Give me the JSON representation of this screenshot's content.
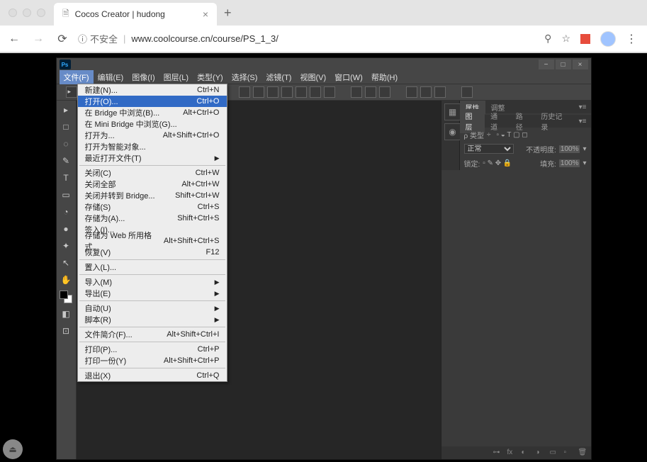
{
  "browser": {
    "tab_title": "Cocos Creator | hudong",
    "insecure_label": "不安全",
    "url": "www.coolcourse.cn/course/PS_1_3/"
  },
  "ps": {
    "logo": "Ps",
    "menubar": [
      "文件(F)",
      "编辑(E)",
      "图像(I)",
      "图层(L)",
      "类型(Y)",
      "选择(S)",
      "滤镜(T)",
      "视图(V)",
      "窗口(W)",
      "帮助(H)"
    ],
    "win_ctrls": [
      "−",
      "□",
      "×"
    ]
  },
  "file_menu": {
    "groups": [
      [
        {
          "label": "新建(N)...",
          "shortcut": "Ctrl+N"
        },
        {
          "label": "打开(O)...",
          "shortcut": "Ctrl+O",
          "hover": true
        },
        {
          "label": "在 Bridge 中浏览(B)...",
          "shortcut": "Alt+Ctrl+O"
        },
        {
          "label": "在 Mini Bridge 中浏览(G)..."
        },
        {
          "label": "打开为...",
          "shortcut": "Alt+Shift+Ctrl+O"
        },
        {
          "label": "打开为智能对象..."
        },
        {
          "label": "最近打开文件(T)",
          "submenu": true
        }
      ],
      [
        {
          "label": "关闭(C)",
          "shortcut": "Ctrl+W"
        },
        {
          "label": "关闭全部",
          "shortcut": "Alt+Ctrl+W"
        },
        {
          "label": "关闭并转到 Bridge...",
          "shortcut": "Shift+Ctrl+W"
        },
        {
          "label": "存储(S)",
          "shortcut": "Ctrl+S"
        },
        {
          "label": "存储为(A)...",
          "shortcut": "Shift+Ctrl+S"
        },
        {
          "label": "签入(I)..."
        },
        {
          "label": "存储为 Web 所用格式...",
          "shortcut": "Alt+Shift+Ctrl+S"
        },
        {
          "label": "恢复(V)",
          "shortcut": "F12"
        }
      ],
      [
        {
          "label": "置入(L)..."
        }
      ],
      [
        {
          "label": "导入(M)",
          "submenu": true
        },
        {
          "label": "导出(E)",
          "submenu": true
        }
      ],
      [
        {
          "label": "自动(U)",
          "submenu": true
        },
        {
          "label": "脚本(R)",
          "submenu": true
        }
      ],
      [
        {
          "label": "文件简介(F)...",
          "shortcut": "Alt+Shift+Ctrl+I"
        }
      ],
      [
        {
          "label": "打印(P)...",
          "shortcut": "Ctrl+P"
        },
        {
          "label": "打印一份(Y)",
          "shortcut": "Alt+Shift+Ctrl+P"
        }
      ],
      [
        {
          "label": "退出(X)",
          "shortcut": "Ctrl+Q"
        }
      ]
    ]
  },
  "panels": {
    "top_tabs": [
      "属性",
      "调整"
    ],
    "layer_tabs": [
      "图层",
      "通道",
      "路径",
      "历史记录"
    ],
    "kind_label": "ρ 类型",
    "kind_suffix": "÷",
    "blend_mode": "正常",
    "opacity_label": "不透明度:",
    "opacity_value": "100%",
    "lock_label": "锁定:",
    "fill_label": "填充:",
    "fill_value": "100%"
  },
  "tools": [
    "▸",
    "□",
    "◌",
    "✎",
    "T",
    "▭",
    "◔",
    "●",
    "✦",
    "↖",
    "✋"
  ]
}
